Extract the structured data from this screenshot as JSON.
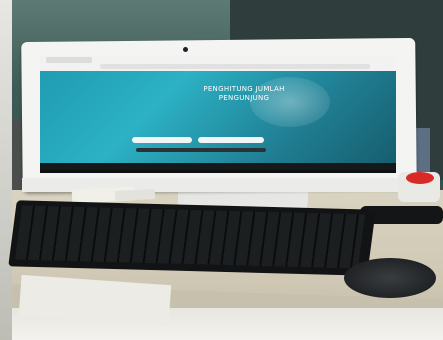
{
  "screen": {
    "title_line1": "PENGHITUNG JUMLAH",
    "title_line2": "PENGUNJUNG"
  },
  "colors": {
    "screen_teal": "#2cb1c4",
    "button_dark": "#2a3236",
    "indicator_red": "#d82b27"
  }
}
